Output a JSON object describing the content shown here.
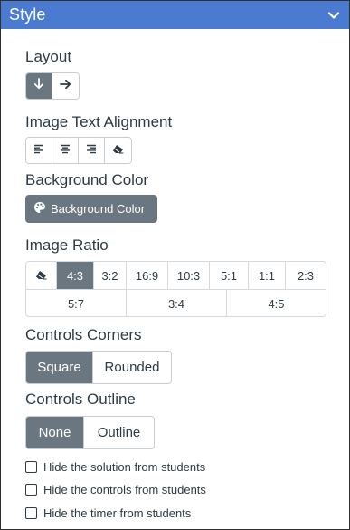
{
  "panel": {
    "title": "Style"
  },
  "layout": {
    "label": "Layout"
  },
  "image_text_alignment": {
    "label": "Image Text Alignment"
  },
  "background_color": {
    "label": "Background Color",
    "button_label": "Background Color"
  },
  "image_ratio": {
    "label": "Image Ratio",
    "row1": [
      "4:3",
      "3:2",
      "16:9",
      "10:3",
      "5:1",
      "1:1",
      "2:3"
    ],
    "row2": [
      "5:7",
      "3:4",
      "4:5"
    ],
    "selected": "4:3"
  },
  "controls_corners": {
    "label": "Controls Corners",
    "options": [
      "Square",
      "Rounded"
    ],
    "selected": "Square"
  },
  "controls_outline": {
    "label": "Controls Outline",
    "options": [
      "None",
      "Outline"
    ],
    "selected": "None"
  },
  "checkboxes": [
    {
      "label": "Hide the solution from students",
      "checked": false
    },
    {
      "label": "Hide the controls from students",
      "checked": false
    },
    {
      "label": "Hide the timer from students",
      "checked": false
    }
  ],
  "colors": {
    "header": "#4a7bd1",
    "active": "#6b7780",
    "text": "#2d3b45"
  },
  "icons": [
    "chevron-down-icon",
    "arrow-down-icon",
    "arrow-right-icon",
    "align-left-icon",
    "align-center-icon",
    "align-right-icon",
    "eraser-icon",
    "palette-icon"
  ]
}
